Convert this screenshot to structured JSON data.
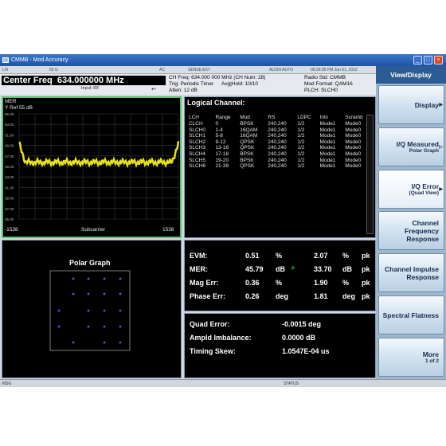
{
  "window": {
    "title": "CMMB - Mod Accuracy"
  },
  "status_strip": {
    "lxi": "LXI",
    "impedance": "50 Ω",
    "coupling": "AC",
    "sense": "SENSE:EXT",
    "align": "ALIGN AUTO",
    "datetime": "06:26:05 PM Jun 01, 2010"
  },
  "header": {
    "center_freq_label": "Center Freq",
    "center_freq_value": "634.000000 MHz",
    "input": "Input: RF",
    "ch_freq": "CH Freq: 634.000 000 MHz (CH Num: 28)",
    "trig": "Trig: Periodic Timer",
    "avg_hold": "Avg|Hold: 10/10",
    "atten": "Atten: 12 dB",
    "radio_std": "Radio Std: CMMB",
    "mod_format": "Mod Format: QAM16",
    "plch": "PLCH: SLCH0"
  },
  "spectrum": {
    "title": "MER",
    "yref": "Y Ref  55 dB",
    "x_label": "Subcarrier",
    "x_min": "-1538",
    "x_max": "1538",
    "y_ticks": [
      "55.00",
      "53.00",
      "51.00",
      "49.00",
      "47.00",
      "45.00",
      "43.00",
      "41.00",
      "39.00",
      "37.00",
      "35.00"
    ]
  },
  "logical_channel": {
    "title": "Logical Channel:",
    "columns": [
      "LCH",
      "Range",
      "Mod",
      "RS",
      "LDPC",
      "Intv",
      "Scramb"
    ],
    "rows": [
      [
        "CLCH",
        "0",
        "BPSK",
        "240,240",
        "1/2",
        "Mode1",
        "Mode0"
      ],
      [
        "SLCH0",
        "1-4",
        "16QAM",
        "240,240",
        "1/2",
        "Mode1",
        "Mode0"
      ],
      [
        "SLCH1",
        "5-8",
        "16QAM",
        "240,240",
        "1/2",
        "Mode1",
        "Mode0"
      ],
      [
        "SLCH2",
        "9-12",
        "QPSK",
        "240,240",
        "1/2",
        "Mode1",
        "Mode0"
      ],
      [
        "SLCH3",
        "13-16",
        "QPSK",
        "240,240",
        "1/2",
        "Mode1",
        "Mode0"
      ],
      [
        "SLCH4",
        "17-18",
        "BPSK",
        "240,240",
        "1/2",
        "Mode1",
        "Mode0"
      ],
      [
        "SLCH5",
        "19-20",
        "BPSK",
        "240,240",
        "1/2",
        "Mode1",
        "Mode0"
      ],
      [
        "SLCH6",
        "21-39",
        "QPSK",
        "240,240",
        "1/2",
        "Mode1",
        "Mode0"
      ]
    ]
  },
  "polar": {
    "title": "Polar Graph"
  },
  "metrics": {
    "rows": [
      {
        "label": "EVM:",
        "v1": "0.51",
        "u1": "%",
        "flag": "",
        "v2": "2.07",
        "u2": "%",
        "pk": "pk"
      },
      {
        "label": "MER:",
        "v1": "45.79",
        "u1": "dB",
        "flag": "P",
        "v2": "33.70",
        "u2": "dB",
        "pk": "pk"
      },
      {
        "label": "Mag Err:",
        "v1": "0.36",
        "u1": "%",
        "flag": "",
        "v2": "1.90",
        "u2": "%",
        "pk": "pk"
      },
      {
        "label": "Phase Err:",
        "v1": "0.26",
        "u1": "deg",
        "flag": "",
        "v2": "1.81",
        "u2": "deg",
        "pk": "pk"
      }
    ]
  },
  "quad": {
    "rows": [
      {
        "label": "Quad Error:",
        "value": "-0.0015 deg"
      },
      {
        "label": "Ampld Imbalance:",
        "value": "0.0000 dB"
      },
      {
        "label": "Timing Skew:",
        "value": "1.0547E-04 us"
      }
    ]
  },
  "softkeys": {
    "header": "View/Display",
    "items": [
      {
        "label": "Display",
        "sub": "",
        "arrow": "▶"
      },
      {
        "label": "I/Q Measured",
        "sub": "Polar Graph",
        "arrow": "▷"
      },
      {
        "label": "I/Q Error",
        "sub": "(Quad View)",
        "arrow": "▶"
      },
      {
        "label": "Channel Frequency Response",
        "sub": "",
        "arrow": ""
      },
      {
        "label": "Channel Impulse Response",
        "sub": "",
        "arrow": ""
      },
      {
        "label": "Spectral Flatness",
        "sub": "",
        "arrow": ""
      },
      {
        "label": "More",
        "sub": "1 of 2",
        "arrow": ""
      }
    ]
  },
  "bottom": {
    "msg": "MSG",
    "status": "STATUS"
  },
  "colors": {
    "trace": "#e8e01a",
    "constellation": "#4a56ff",
    "active_border": "#55c26c"
  }
}
